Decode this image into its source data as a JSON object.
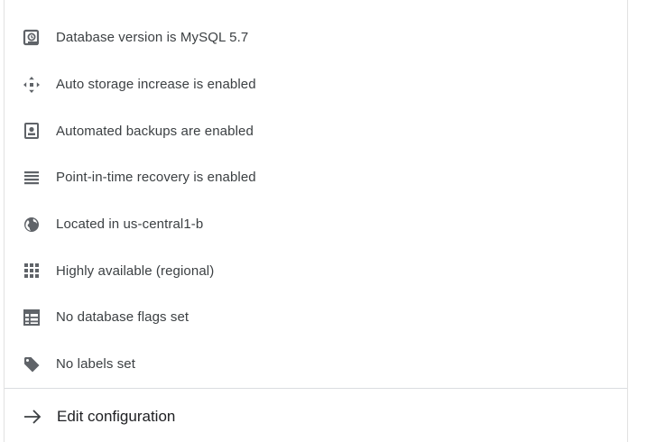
{
  "config_items": [
    {
      "icon": "database-version-icon",
      "label": "Database version is MySQL 5.7"
    },
    {
      "icon": "storage-increase-icon",
      "label": "Auto storage increase is enabled"
    },
    {
      "icon": "backup-icon",
      "label": "Automated backups are enabled"
    },
    {
      "icon": "recovery-icon",
      "label": "Point-in-time recovery is enabled"
    },
    {
      "icon": "globe-icon",
      "label": "Located in us-central1-b"
    },
    {
      "icon": "grid-icon",
      "label": "Highly available (regional)"
    },
    {
      "icon": "table-icon",
      "label": "No database flags set"
    },
    {
      "icon": "label-tag-icon",
      "label": "No labels set"
    }
  ],
  "edit": {
    "icon": "arrow-right-icon",
    "label": "Edit configuration"
  },
  "colors": {
    "icon": "#5f6368",
    "text": "#3c4043",
    "divider": "#dadce0"
  }
}
